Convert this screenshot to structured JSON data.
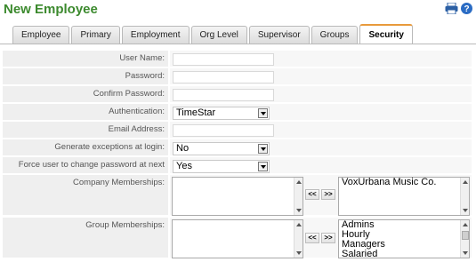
{
  "header": {
    "title": "New Employee",
    "icons": [
      "printer-icon",
      "help-icon"
    ]
  },
  "tabs": [
    {
      "label": "Employee"
    },
    {
      "label": "Primary"
    },
    {
      "label": "Employment"
    },
    {
      "label": "Org Level"
    },
    {
      "label": "Supervisor"
    },
    {
      "label": "Groups"
    },
    {
      "label": "Security",
      "active": true
    }
  ],
  "form": {
    "username_label": "User Name:",
    "username_value": "",
    "password_label": "Password:",
    "password_value": "",
    "confirm_password_label": "Confirm Password:",
    "confirm_password_value": "",
    "authentication_label": "Authentication:",
    "authentication_value": "TimeStar",
    "email_label": "Email Address:",
    "email_value": "",
    "generate_exceptions_label": "Generate exceptions at login:",
    "generate_exceptions_value": "No",
    "force_change_label": "Force user to change password at next login:",
    "force_change_value": "Yes",
    "company_label": "Company Memberships:",
    "company_available": [],
    "company_selected": [
      "VoxUrbana Music Co."
    ],
    "group_label": "Group Memberships:",
    "group_available": [],
    "group_selected": [
      "Admins",
      "Hourly",
      "Managers",
      "Salaried"
    ],
    "move_left_label": "<<",
    "move_right_label": ">>"
  }
}
